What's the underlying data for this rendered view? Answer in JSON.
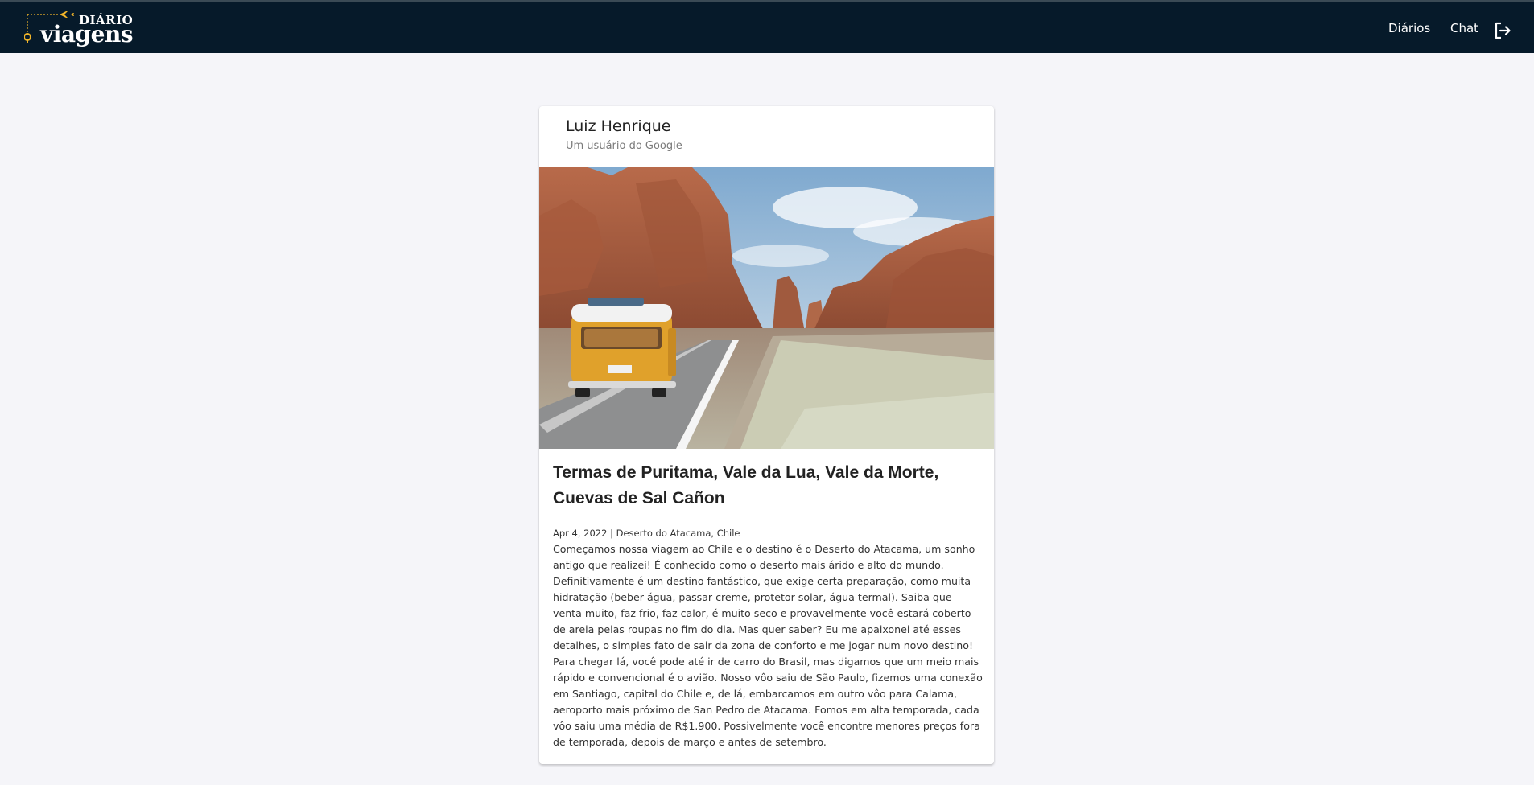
{
  "header": {
    "logo": {
      "small": "DIÁRIO",
      "big": "viagens",
      "accent_color": "#f0b429"
    },
    "nav": {
      "diarios": "Diários",
      "chat": "Chat"
    },
    "logout_icon": "logout-icon",
    "background_color": "#061a2a"
  },
  "post": {
    "author": {
      "name": "Luiz Henrique",
      "subtitle": "Um usuário do Google"
    },
    "image": {
      "description_icon": "photo-van-canyon-road"
    },
    "title": "Termas de Puritama, Vale da Lua, Vale da Morte, Cuevas de Sal Cañon",
    "meta": "Apr 4, 2022 | Deserto do Atacama, Chile",
    "body": "Começamos nossa viagem ao Chile e o destino é o Deserto do Atacama, um sonho antigo que realizei! É conhecido como o deserto mais árido e alto do mundo. Definitivamente é um destino fantástico, que exige certa preparação, como muita hidratação (beber água, passar creme, protetor solar, água termal). Saiba que venta muito, faz frio, faz calor, é muito seco e provavelmente você estará coberto de areia pelas roupas no fim do dia. Mas quer saber? Eu me apaixonei até esses detalhes, o simples fato de sair da zona de conforto e me jogar num novo destino! Para chegar lá, você pode até ir de carro do Brasil, mas digamos que um meio mais rápido e convencional é o avião. Nosso vôo saiu de São Paulo, fizemos uma conexão em Santiago, capital do Chile e, de lá, embarcamos em outro vôo para Calama, aeroporto mais próximo de San Pedro de Atacama. Fomos em alta temporada, cada vôo saiu uma média de R$1.900. Possivelmente você encontre menores preços fora de temporada, depois de março e antes de setembro."
  }
}
